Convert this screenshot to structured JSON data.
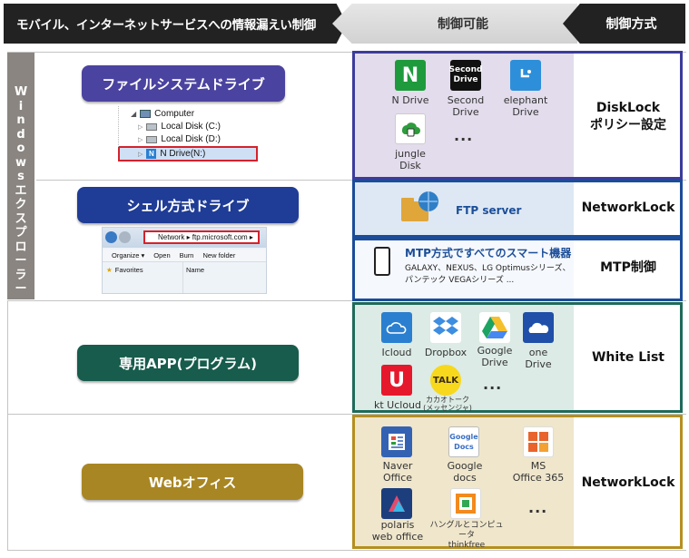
{
  "header": {
    "left": "モバイル、インターネットサービスへの情報漏えい制御",
    "middle": "制御可能",
    "right": "制御方式"
  },
  "sidebar": {
    "chars": [
      "W",
      "i",
      "n",
      "d",
      "o",
      "w",
      "s",
      "エ",
      "ク",
      "ス",
      "プ",
      "ロ",
      "ー",
      "ラ",
      "ー"
    ]
  },
  "rows": {
    "filesystem": {
      "pill": "ファイルシステムドライブ",
      "tree": {
        "computer": "Computer",
        "disk_c": "Local Disk  (C:)",
        "disk_d": "Local Disk  (D:)",
        "ndrive": "N Drive(N:)"
      },
      "services": [
        {
          "name": "N Drive",
          "icon_text": "N"
        },
        {
          "name": "Second\nDrive",
          "icon_text": "Second\nDrive"
        },
        {
          "name": "elephant\nDrive",
          "icon_text": ""
        },
        {
          "name": "jungle\nDisk",
          "icon_text": ""
        }
      ],
      "dots": "...",
      "method": "DiskLock\nポリシー設定"
    },
    "shell": {
      "pill": "シェル方式ドライブ",
      "explorer": {
        "address": "Network  ▸  ftp.microsoft.com  ▸",
        "organize": "Organize ▾",
        "open": "Open",
        "burn": "Burn",
        "newfolder": "New folder",
        "favorites": "Favorites",
        "name_col": "Name"
      },
      "ftp_label": "FTP server",
      "ftp_method": "NetworkLock",
      "mtp_title": "MTP方式ですべてのスマート機器",
      "mtp_line2": "GALAXY、NEXUS、LG  Optimusシリーズ、",
      "mtp_line3": "パンテック  VEGAシリーズ  ...",
      "mtp_method": "MTP制御"
    },
    "app": {
      "pill": "専用APP(プログラム)",
      "services": [
        {
          "name": "Icloud"
        },
        {
          "name": "Dropbox"
        },
        {
          "name": "Google\nDrive"
        },
        {
          "name": "one\nDrive"
        },
        {
          "name": "kt Ucloud",
          "icon_text": "U"
        },
        {
          "name": "カカオトーク\n(メッセンジャ)",
          "icon_text": "TALK"
        }
      ],
      "dots": "...",
      "method": "White List"
    },
    "web": {
      "pill": "Webオフィス",
      "services": [
        {
          "name": "Naver\nOffice"
        },
        {
          "name": "Google\ndocs",
          "icon_text": "Google\nDocs"
        },
        {
          "name": "MS\nOffice 365"
        },
        {
          "name": "polaris\nweb office"
        },
        {
          "name": "ハングルとコンピュータ\nthinkfree"
        }
      ],
      "dots": "...",
      "method": "NetworkLock"
    }
  },
  "colors": {
    "pill_purple": "#4b43a0",
    "pill_blue": "#1f3c96",
    "pill_teal": "#175c4c",
    "pill_gold": "#a88623",
    "box_purple": "#3c3b9c",
    "box_blue": "#1b4c9a",
    "box_teal": "#1f6a5a",
    "box_gold": "#b58f1e"
  }
}
